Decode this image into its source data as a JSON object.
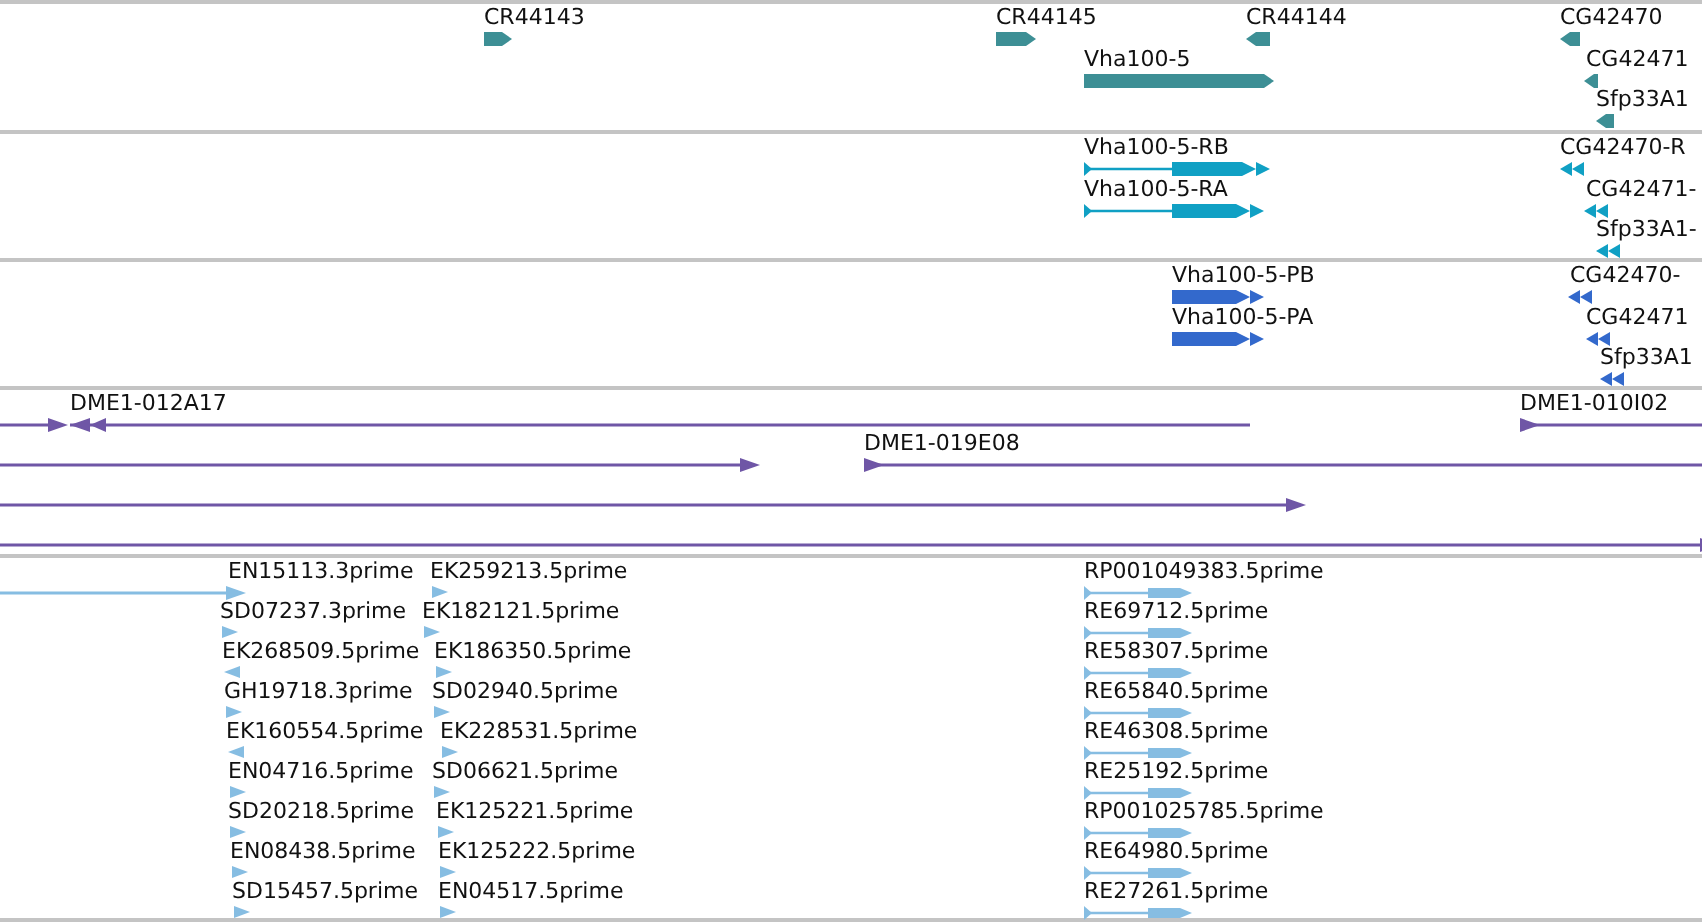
{
  "tracks": [
    {
      "color": "#3d8f95",
      "features": [
        {
          "label": "CR44143",
          "reverse": false
        },
        {
          "label": "CR44145",
          "reverse": false
        },
        {
          "label": "CR44144",
          "reverse": true
        },
        {
          "label": "Vha100-5",
          "reverse": false
        },
        {
          "label": "CG42470",
          "reverse": true
        },
        {
          "label": "CG42471",
          "reverse": true
        },
        {
          "label": "Sfp33A1",
          "reverse": true
        }
      ]
    },
    {
      "color": "#10a0c4",
      "features": [
        {
          "label": "Vha100-5-RB",
          "reverse": false
        },
        {
          "label": "Vha100-5-RA",
          "reverse": false
        },
        {
          "label": "CG42470-R",
          "reverse": true
        },
        {
          "label": "CG42471-",
          "reverse": true
        },
        {
          "label": "Sfp33A1-",
          "reverse": true
        }
      ]
    },
    {
      "color": "#3369cc",
      "features": [
        {
          "label": "Vha100-5-PB",
          "reverse": false
        },
        {
          "label": "Vha100-5-PA",
          "reverse": false
        },
        {
          "label": "CG42470-",
          "reverse": true
        },
        {
          "label": "CG42471",
          "reverse": true
        },
        {
          "label": "Sfp33A1",
          "reverse": true
        }
      ]
    },
    {
      "color": "#6f56a6",
      "features": [
        {
          "reverse": false
        },
        {
          "label": "DME1-012A17",
          "reverse": true
        },
        {
          "label": "DME1-010I02",
          "reverse": false
        },
        {
          "reverse": false
        },
        {
          "label": "DME1-019E08",
          "reverse": false
        },
        {
          "reverse": false
        },
        {
          "reverse": false
        }
      ]
    },
    {
      "color": "#86bde2",
      "features": [
        {
          "label": "EN15113.3prime",
          "reverse": false
        },
        {
          "label": "SD07237.3prime",
          "reverse": false
        },
        {
          "label": "EK268509.5prime",
          "reverse": true
        },
        {
          "label": "GH19718.3prime",
          "reverse": false
        },
        {
          "label": "EK160554.5prime",
          "reverse": true
        },
        {
          "label": "EN04716.5prime",
          "reverse": false
        },
        {
          "label": "SD20218.5prime",
          "reverse": false
        },
        {
          "label": "EN08438.5prime",
          "reverse": false
        },
        {
          "label": "SD15457.5prime",
          "reverse": false
        },
        {
          "label": "EK259213.5prime",
          "reverse": false
        },
        {
          "label": "EK182121.5prime",
          "reverse": false
        },
        {
          "label": "EK186350.5prime",
          "reverse": false
        },
        {
          "label": "SD02940.5prime",
          "reverse": false
        },
        {
          "label": "EK228531.5prime",
          "reverse": false
        },
        {
          "label": "SD06621.5prime",
          "reverse": false
        },
        {
          "label": "EK125221.5prime",
          "reverse": false
        },
        {
          "label": "EK125222.5prime",
          "reverse": false
        },
        {
          "label": "EN04517.5prime",
          "reverse": false
        },
        {
          "label": "RP001049383.5prime",
          "reverse": false
        },
        {
          "label": "RE69712.5prime",
          "reverse": false
        },
        {
          "label": "RE58307.5prime",
          "reverse": false
        },
        {
          "label": "RE65840.5prime",
          "reverse": false
        },
        {
          "label": "RE46308.5prime",
          "reverse": false
        },
        {
          "label": "RE25192.5prime",
          "reverse": false
        },
        {
          "label": "RP001025785.5prime",
          "reverse": false
        },
        {
          "label": "RE64980.5prime",
          "reverse": false
        },
        {
          "label": "RE27261.5prime",
          "reverse": false
        }
      ]
    }
  ]
}
